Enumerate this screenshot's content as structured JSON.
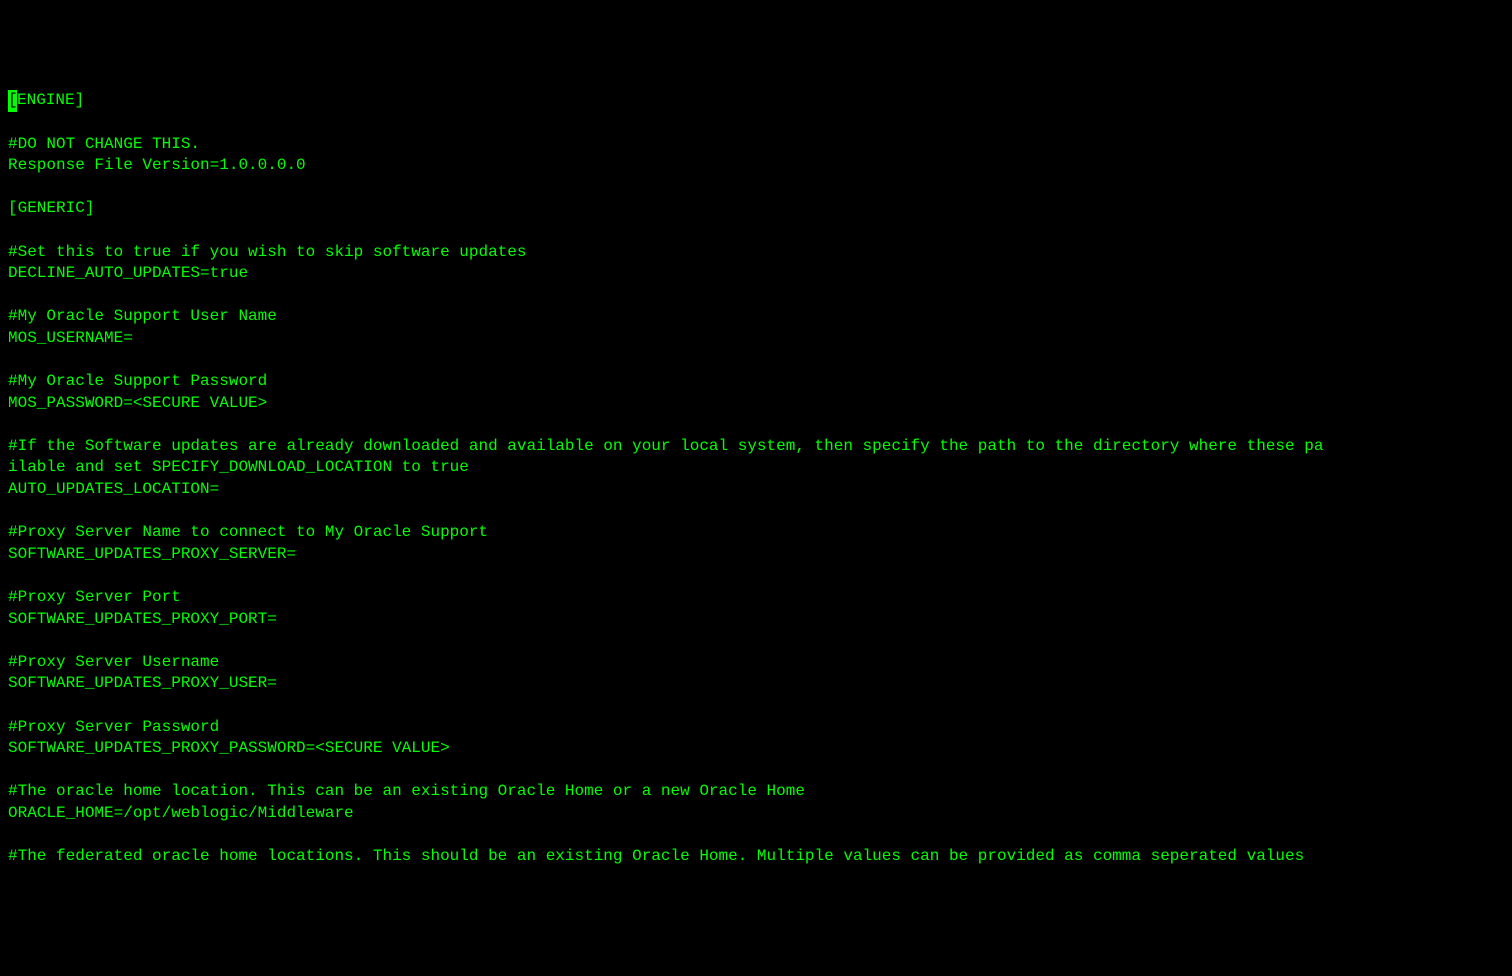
{
  "lines": [
    "[ENGINE]",
    "",
    "#DO NOT CHANGE THIS.",
    "Response File Version=1.0.0.0.0",
    "",
    "[GENERIC]",
    "",
    "#Set this to true if you wish to skip software updates",
    "DECLINE_AUTO_UPDATES=true",
    "",
    "#My Oracle Support User Name",
    "MOS_USERNAME=",
    "",
    "#My Oracle Support Password",
    "MOS_PASSWORD=<SECURE VALUE>",
    "",
    "#If the Software updates are already downloaded and available on your local system, then specify the path to the directory where these pa",
    "ilable and set SPECIFY_DOWNLOAD_LOCATION to true",
    "AUTO_UPDATES_LOCATION=",
    "",
    "#Proxy Server Name to connect to My Oracle Support",
    "SOFTWARE_UPDATES_PROXY_SERVER=",
    "",
    "#Proxy Server Port",
    "SOFTWARE_UPDATES_PROXY_PORT=",
    "",
    "#Proxy Server Username",
    "SOFTWARE_UPDATES_PROXY_USER=",
    "",
    "#Proxy Server Password",
    "SOFTWARE_UPDATES_PROXY_PASSWORD=<SECURE VALUE>",
    "",
    "#The oracle home location. This can be an existing Oracle Home or a new Oracle Home",
    "ORACLE_HOME=/opt/weblogic/Middleware",
    "",
    "#The federated oracle home locations. This should be an existing Oracle Home. Multiple values can be provided as comma seperated values"
  ],
  "cursor": {
    "line": 0,
    "col": 0
  }
}
